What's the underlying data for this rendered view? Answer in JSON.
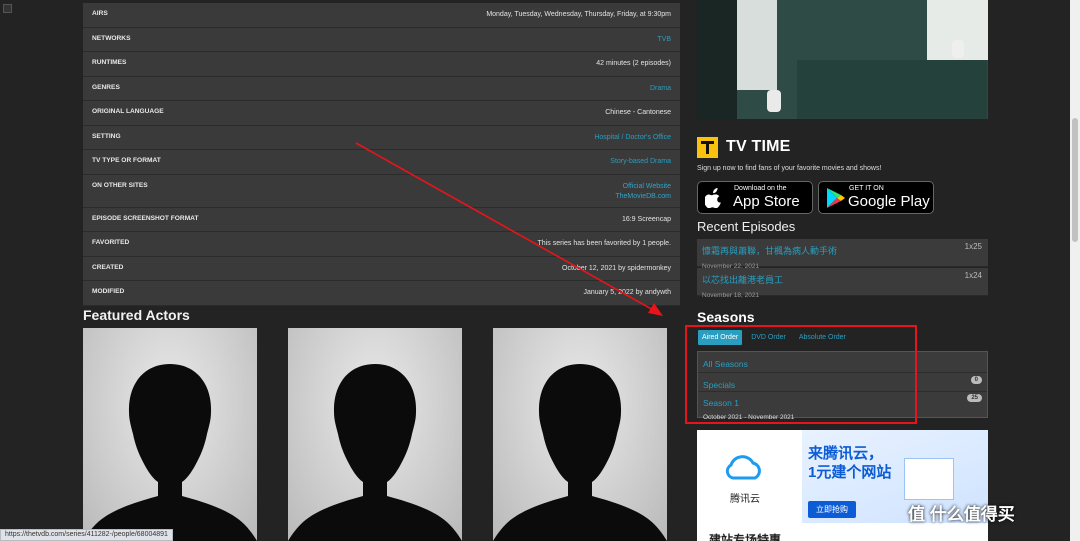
{
  "info_rows": [
    {
      "key": "AIRS",
      "value": "Monday, Tuesday, Wednesday, Thursday, Friday, at 9:30pm"
    },
    {
      "key": "NETWORKS",
      "value": "TVB"
    },
    {
      "key": "RUNTIMES",
      "value": "42 minutes (2 episodes)"
    },
    {
      "key": "GENRES",
      "value": "Drama"
    },
    {
      "key": "ORIGINAL LANGUAGE",
      "value": "Chinese - Cantonese"
    },
    {
      "key": "SETTING",
      "value": "Hospital / Doctor's Office"
    },
    {
      "key": "TV TYPE OR FORMAT",
      "value": "Story-based Drama"
    },
    {
      "key": "ON OTHER SITES",
      "value": "Official Website",
      "value2": "TheMovieDB.com"
    },
    {
      "key": "EPISODE SCREENSHOT FORMAT",
      "value": "16:9 Screencap"
    },
    {
      "key": "FAVORITED",
      "value": "This series has been favorited by 1 people."
    },
    {
      "key": "CREATED",
      "value": "October 12, 2021 by spidermonkey"
    },
    {
      "key": "MODIFIED",
      "value": "January 5, 2022 by andywth"
    }
  ],
  "featured_actors_title": "Featured Actors",
  "tvtime": {
    "title": "TV TIME",
    "subtitle": "Sign up now to find fans of your favorite movies and shows!",
    "appstore_small": "Download on the",
    "appstore_big": "App Store",
    "googleplay_small": "GET IT ON",
    "googleplay_big": "Google Play"
  },
  "recent_episodes": {
    "title": "Recent Episodes",
    "items": [
      {
        "title": "慷霜再與蕭聯，甘楓為病人動手術",
        "date": "November 22, 2021",
        "num": "1x25"
      },
      {
        "title": "以芯找出離港老員工",
        "date": "November 18, 2021",
        "num": "1x24"
      }
    ]
  },
  "seasons": {
    "title": "Seasons",
    "tabs": [
      "Aired Order",
      "DVD Order",
      "Absolute Order"
    ],
    "rows": [
      {
        "label": "All Seasons"
      },
      {
        "label": "Specials",
        "badge": "0"
      },
      {
        "label": "Season 1",
        "dates": "October 2021 - November 2021",
        "badge": "25"
      }
    ]
  },
  "ad": {
    "brand": "腾讯云",
    "headline1": "来腾讯云，",
    "headline2": "1元建个网站",
    "cta": "立即抢购",
    "bottom": "建站专场特惠"
  },
  "status_url": "https://thetvdb.com/series/411282-/people/68004891",
  "watermark": "值 什么值得买",
  "colors": {
    "accent": "#2a9ec0",
    "annotation": "#e8141b",
    "tvtime_yellow": "#f9c20f"
  }
}
